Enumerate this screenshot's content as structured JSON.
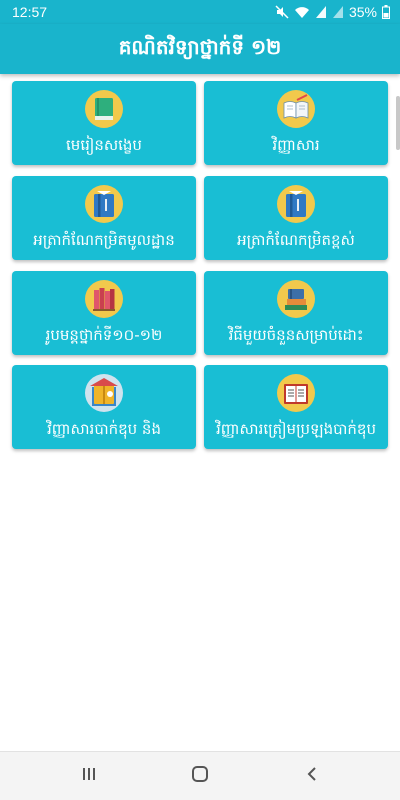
{
  "status_bar": {
    "time": "12:57",
    "battery_percent": "35%",
    "icons": [
      "mute-icon",
      "wifi-icon",
      "signal-icon",
      "signal-icon",
      "battery-icon"
    ]
  },
  "app_bar": {
    "title": "គណិតវិទ្យាថ្នាក់ទី ១២"
  },
  "colors": {
    "primary": "#19b4cc",
    "card": "#19bed4",
    "nav_bar": "#f4f4f4"
  },
  "cards": [
    {
      "label": "មេរៀនសង្ខេប",
      "icon": "green-book-icon"
    },
    {
      "label": "វិញ្ញាសារ",
      "icon": "open-book-pen-icon"
    },
    {
      "label": "អត្រាកំណែកម្រិតមូលដ្ឋាន",
      "icon": "blue-book-icon"
    },
    {
      "label": "អត្រាកំណែកម្រិតខ្ពស់",
      "icon": "blue-book-icon"
    },
    {
      "label": "រូបមន្តថ្នាក់ទី១០-១២",
      "icon": "books-shelf-icon"
    },
    {
      "label": "វិធីមួយចំនួនសម្រាប់ដោះ",
      "icon": "stacked-books-icon"
    },
    {
      "label": "វិញ្ញាសារបាក់ឌុប និង",
      "icon": "yellow-book-icon"
    },
    {
      "label": "វិញ្ញាសារត្រៀមប្រឡងបាក់ឌុប",
      "icon": "open-book-icon"
    }
  ],
  "nav_bar": {
    "buttons": [
      "recents-icon",
      "home-icon",
      "back-icon"
    ]
  }
}
